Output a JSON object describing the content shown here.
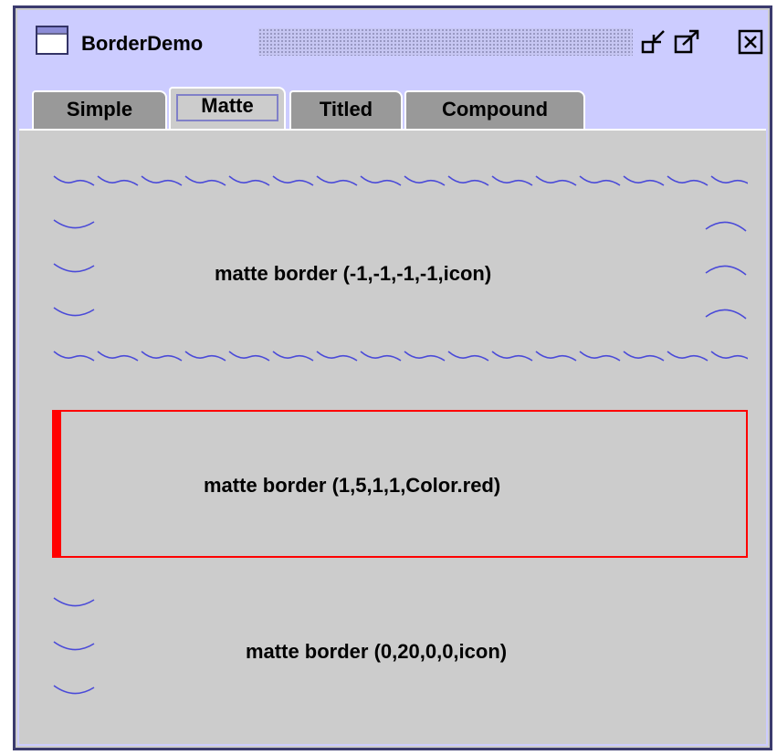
{
  "window": {
    "title": "BorderDemo",
    "icons": [
      "window-icon",
      "iconify-icon",
      "maximize-icon",
      "close-icon"
    ]
  },
  "tabs": [
    {
      "label": "Simple",
      "selected": false
    },
    {
      "label": "Matte",
      "selected": true
    },
    {
      "label": "Titled",
      "selected": false
    },
    {
      "label": "Compound",
      "selected": false
    }
  ],
  "panels": {
    "icon_matte": {
      "label": "matte border (-1,-1,-1,-1,icon)"
    },
    "color_matte": {
      "label": "matte border (1,5,1,1,Color.red)"
    },
    "icon_left_matte": {
      "label": "matte border (0,20,0,0,icon)"
    }
  },
  "colors": {
    "titlebar": "#ccccff",
    "panel": "#cccccc",
    "wave": "#4a4ad8",
    "matte_red": "#ff0000",
    "tab_inactive": "#999999"
  }
}
